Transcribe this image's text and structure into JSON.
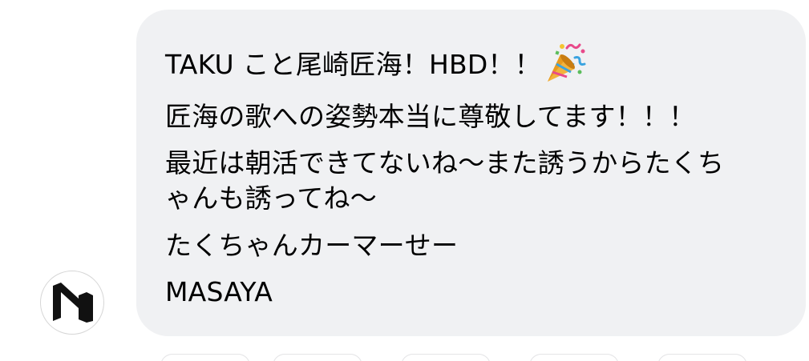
{
  "message": {
    "lines": [
      "TAKU こと尾崎匠海！HBD！！",
      "匠海の歌への姿勢本当に尊敬してます！！！",
      "最近は朝活できてないね～また誘うからたくち",
      "ゃんも誘ってね～",
      "たくちゃんカーマーせー",
      "MASAYA"
    ],
    "emoji_icon": "party-popper-icon"
  },
  "avatar": {
    "icon": "logo-avatar-icon"
  },
  "colors": {
    "bubble_background": "#f0f1f3",
    "text": "#000000",
    "avatar_border": "#d6d6d6"
  }
}
